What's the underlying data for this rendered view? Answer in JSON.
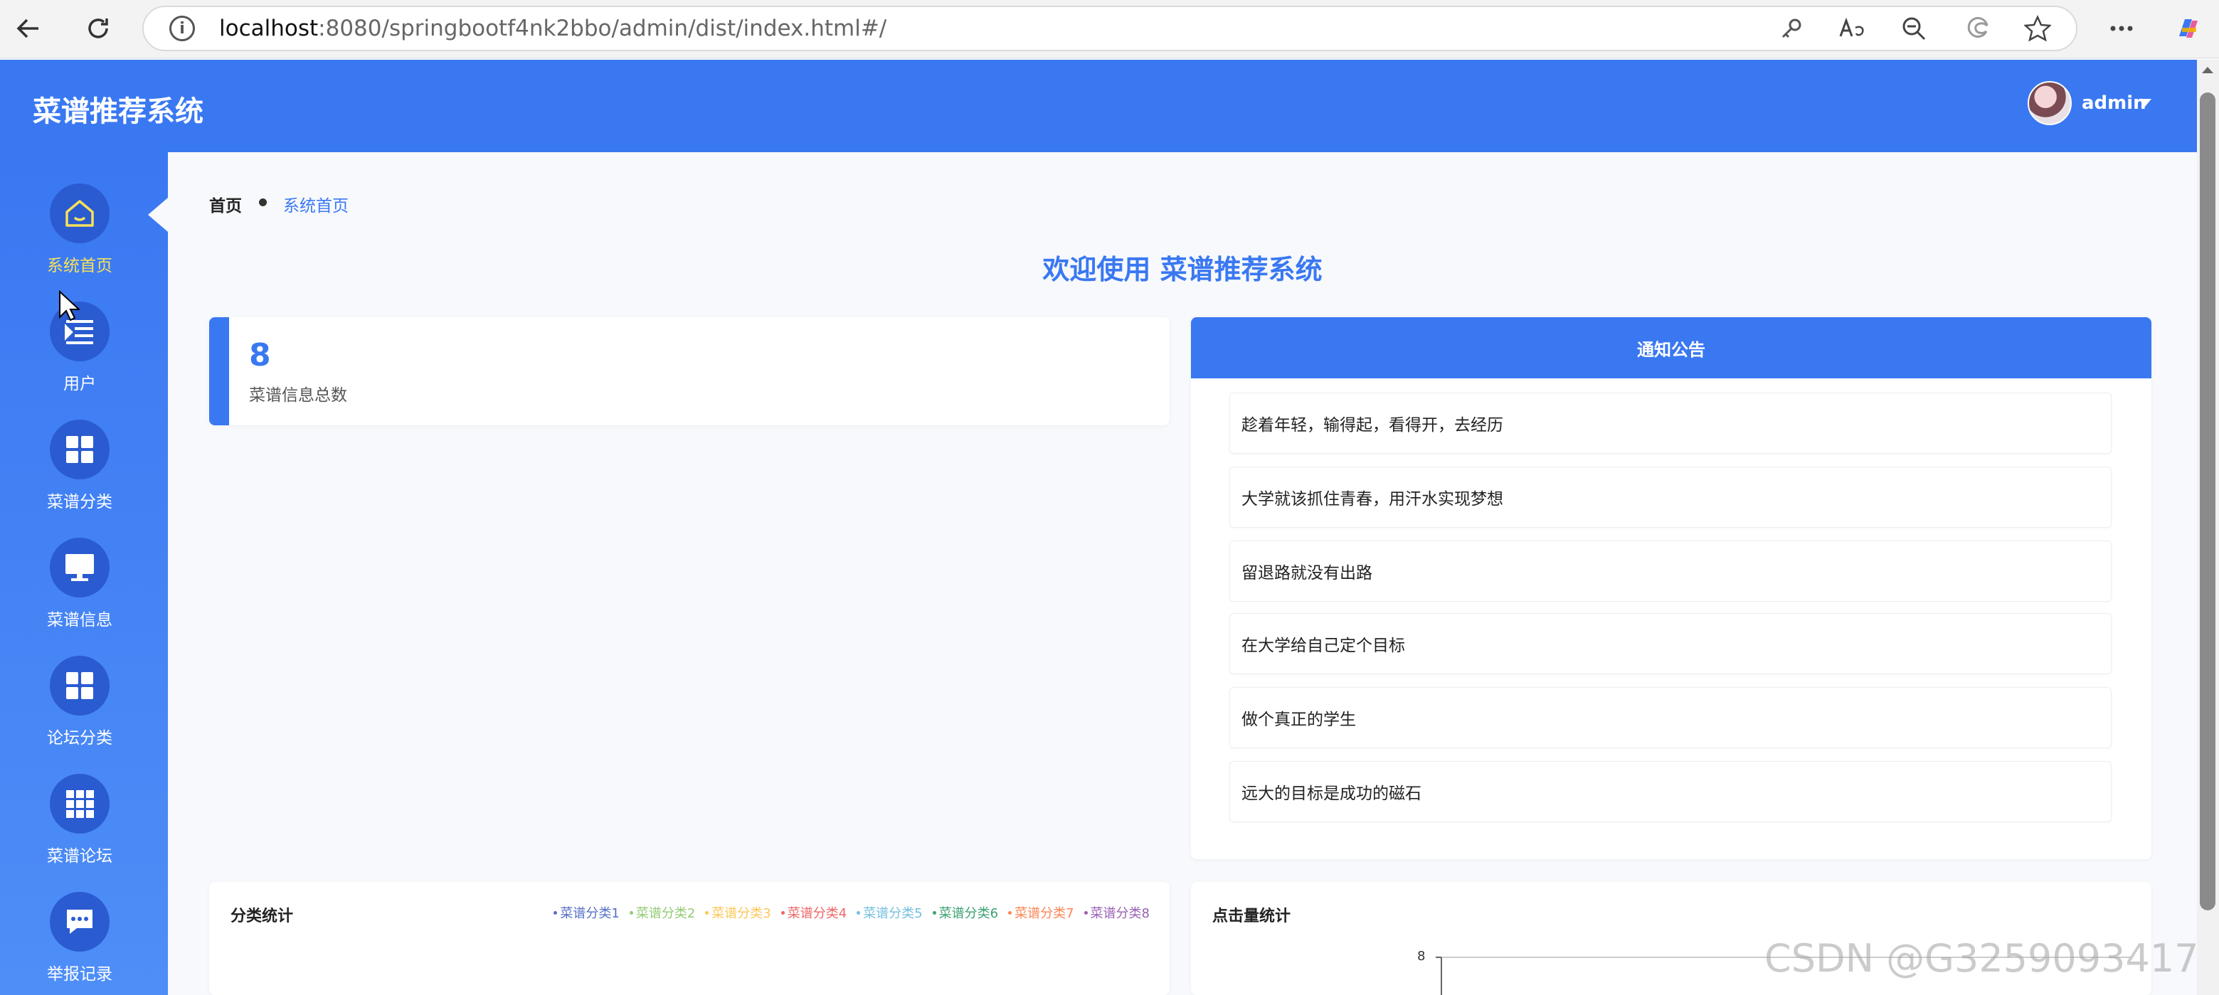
{
  "browser": {
    "url_host": "localhost",
    "url_rest": ":8080/springbootf4nk2bbo/admin/dist/index.html#/",
    "info_glyph": "i"
  },
  "header": {
    "title": "菜谱推荐系统",
    "user": "admin"
  },
  "sidebar": {
    "items": [
      {
        "label": "系统首页",
        "icon": "home-icon",
        "active": true
      },
      {
        "label": "用户",
        "icon": "list-icon",
        "active": false
      },
      {
        "label": "菜谱分类",
        "icon": "grid-icon",
        "active": false
      },
      {
        "label": "菜谱信息",
        "icon": "monitor-icon",
        "active": false
      },
      {
        "label": "论坛分类",
        "icon": "grid-icon",
        "active": false
      },
      {
        "label": "菜谱论坛",
        "icon": "apps-icon",
        "active": false
      },
      {
        "label": "举报记录",
        "icon": "chat-icon",
        "active": false
      }
    ]
  },
  "breadcrumb": {
    "home": "首页",
    "current": "系统首页"
  },
  "welcome": "欢迎使用 菜谱推荐系统",
  "stat": {
    "value": "8",
    "label": "菜谱信息总数"
  },
  "notice": {
    "title": "通知公告",
    "items": [
      "趁着年轻，输得起，看得开，去经历",
      "大学就该抓住青春，用汗水实现梦想",
      "留退路就没有出路",
      "在大学给自己定个目标",
      "做个真正的学生",
      "远大的目标是成功的磁石"
    ]
  },
  "charts": {
    "category": {
      "title": "分类统计",
      "legend": [
        {
          "name": "菜谱分类1",
          "color": "#5470c6"
        },
        {
          "name": "菜谱分类2",
          "color": "#91cc75"
        },
        {
          "name": "菜谱分类3",
          "color": "#fac858"
        },
        {
          "name": "菜谱分类4",
          "color": "#ee6666"
        },
        {
          "name": "菜谱分类5",
          "color": "#73c0de"
        },
        {
          "name": "菜谱分类6",
          "color": "#3ba272"
        },
        {
          "name": "菜谱分类7",
          "color": "#fc8452"
        },
        {
          "name": "菜谱分类8",
          "color": "#9a60b4"
        }
      ]
    },
    "clicks": {
      "title": "点击量统计",
      "y_max_label": "8"
    }
  },
  "watermark": "CSDN @G3259093417",
  "colors": {
    "primary": "#3a78f2",
    "active_label": "#f7e15a"
  }
}
